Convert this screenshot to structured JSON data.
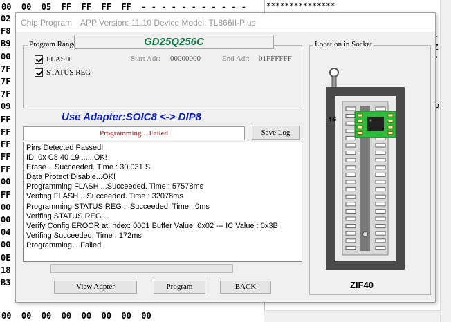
{
  "background": {
    "hex_top_row": "00  00  05  FF  FF  FF  FF  - - - - - - - - - - -",
    "hex_left_column": [
      "02",
      "F8",
      "B9",
      "00",
      "7F",
      "7F",
      "7F",
      "09",
      "FF",
      "FF",
      "FF",
      "FF",
      "FF",
      "00",
      "FF",
      "00",
      "00",
      "04",
      "00",
      "0E",
      "18",
      "B3"
    ],
    "hex_bottom_row": "00  00  00  00  00  00  00  00",
    "right_pane_lines": [
      {
        "text": "***************"
      },
      {
        "text": "04."
      },
      {
        "text": "Z"
      },
      {
        "text": "***"
      },
      {
        "text": "top"
      }
    ]
  },
  "dialog": {
    "title_main": "Chip Program",
    "title_version": "APP Version: 11.10 Device Model: TL866II-Plus",
    "chip_name": "GD25Q256C",
    "program_range": {
      "legend": "Program Range",
      "flash_label": "FLASH",
      "status_reg_label": "STATUS REG",
      "start_adr_label": "Start Adr:",
      "start_adr_value": "00000000",
      "end_adr_label": "End Adr:",
      "end_adr_value": "01FFFFFF"
    },
    "adapter_text": "Use Adapter:SOIC8 <-> DIP8",
    "status_text": "Programming ...Failed",
    "save_log_label": "Save Log",
    "log_lines": [
      "Pins Detected Passed!",
      "ID: 0x C8 40 19 ......OK!",
      "Erase  ...Succeeded. Time : 30.031 S",
      "Data Protect Disable...OK!",
      "Programming FLASH ...Succeeded. Time : 57578ms",
      "Verifing FLASH ...Succeeded. Time : 32078ms",
      "Programming STATUS REG ...Succeeded. Time : 0ms",
      "Verifing STATUS REG ...",
      "Verify Config EROOR at Index: 0001  Buffer Value :0x02 --- IC Value : 0x3B",
      "Verifing Succeeded. Time : 172ms",
      "Programming  ...Failed"
    ],
    "progress": 0,
    "buttons": {
      "view_adapter": "View Adpter",
      "program": "Program",
      "back": "BACK"
    },
    "socket": {
      "legend": "Location in Socket",
      "pin1_label": "1#",
      "socket_name": "ZIF40"
    }
  },
  "colors": {
    "chip_name": "#117a45",
    "adapter_text": "#0d1fcc",
    "status_failed": "#d40000",
    "chip_pcb": "#2dbb3c"
  }
}
